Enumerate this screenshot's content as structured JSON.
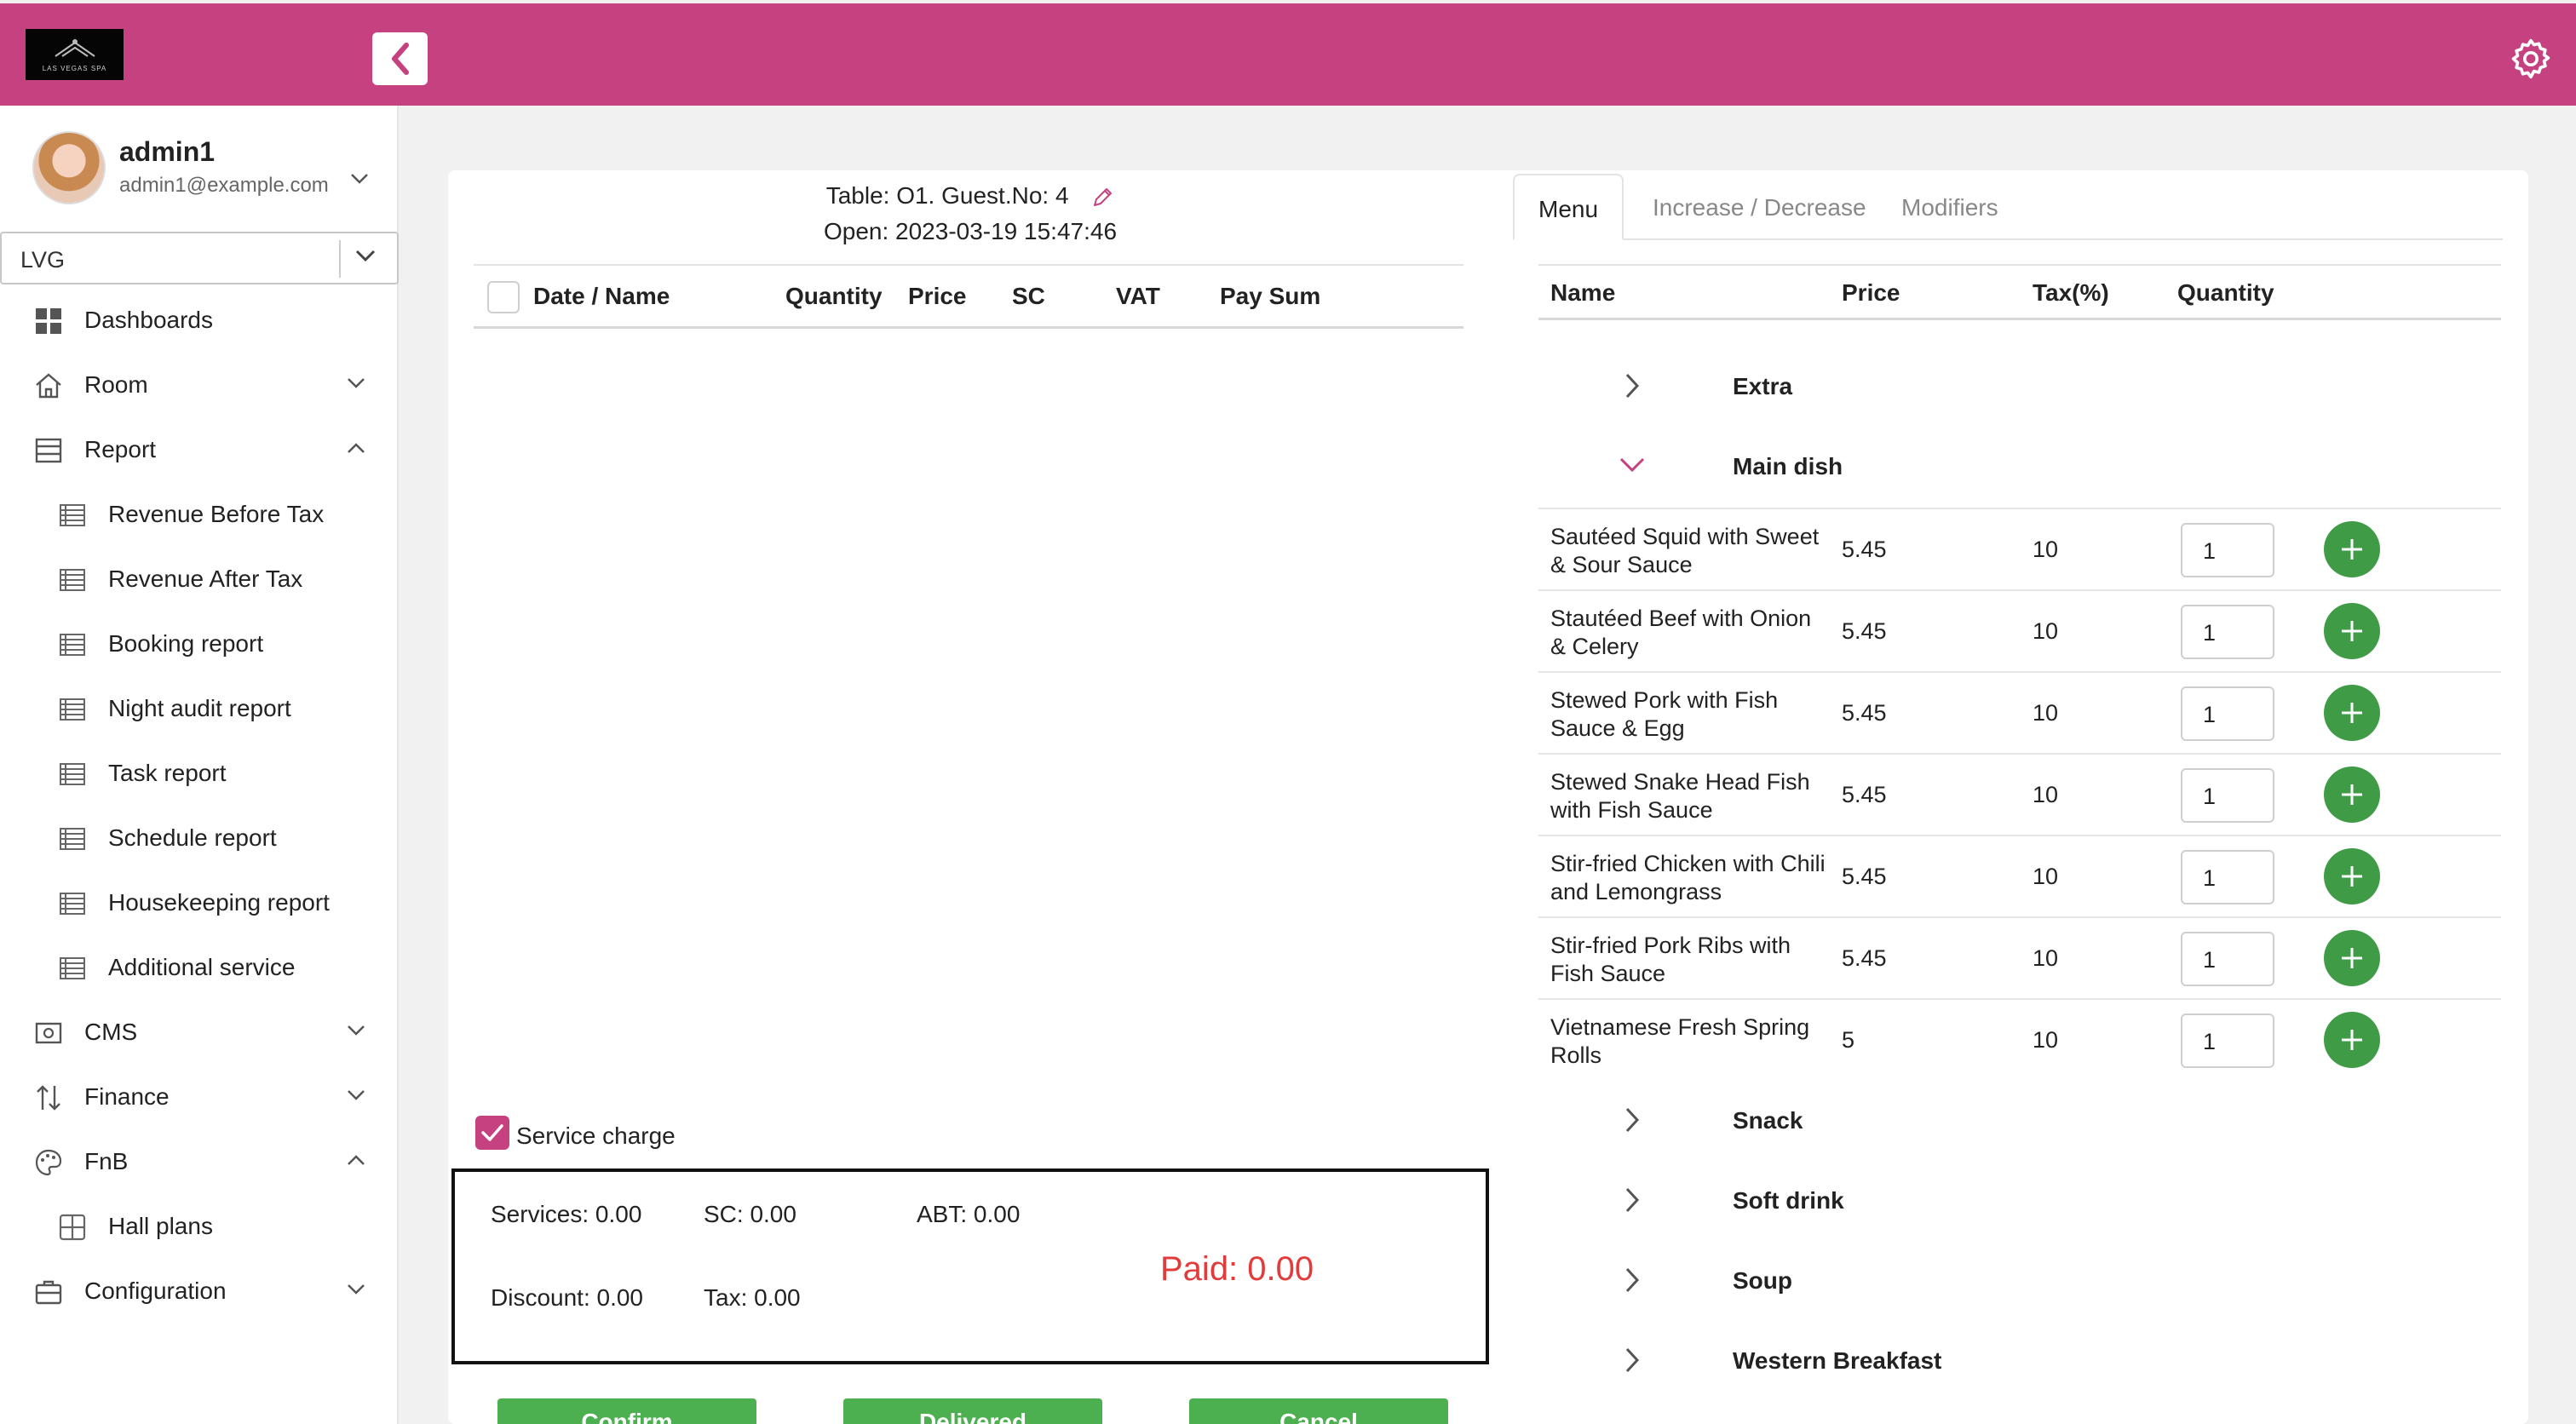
{
  "colors": {
    "brand": "#c6417f",
    "success": "#4caf50",
    "danger": "#e33b3b"
  },
  "logo": {
    "text": "LAS VEGAS SPA"
  },
  "user": {
    "name": "admin1",
    "email": "admin1@example.com"
  },
  "hotel_select": {
    "value": "LVG"
  },
  "nav": {
    "dashboards": "Dashboards",
    "room": "Room",
    "report": "Report",
    "report_items": [
      "Revenue Before Tax",
      "Revenue After Tax",
      "Booking report",
      "Night audit report",
      "Task report",
      "Schedule report",
      "Housekeeping report",
      "Additional service"
    ],
    "cms": "CMS",
    "finance": "Finance",
    "fnb": "FnB",
    "fnb_items": [
      "Hall plans"
    ],
    "configuration": "Configuration"
  },
  "order": {
    "table_line": "Table: O1. Guest.No: 4",
    "open_line": "Open: 2023-03-19 15:47:46",
    "columns": [
      "Date / Name",
      "Quantity",
      "Price",
      "SC",
      "VAT",
      "Pay Sum"
    ],
    "service_charge_label": "Service charge",
    "summary": {
      "services": "Services: 0.00",
      "sc": "SC: 0.00",
      "abt": "ABT: 0.00",
      "discount": "Discount: 0.00",
      "tax": "Tax: 0.00",
      "paid": "Paid: 0.00"
    },
    "buttons": {
      "confirm": "Confirm",
      "delivered": "Delivered",
      "cancel": "Cancel"
    }
  },
  "menu": {
    "tabs": [
      "Menu",
      "Increase / Decrease",
      "Modifiers"
    ],
    "columns": [
      "Name",
      "Price",
      "Tax(%)",
      "Quantity"
    ],
    "groups_before": [
      "Extra"
    ],
    "expanded_group": "Main dish",
    "items": [
      {
        "name": "Sautéed Squid with Sweet & Sour Sauce",
        "price": "5.45",
        "tax": "10",
        "qty": "1"
      },
      {
        "name": "Stautéed Beef with Onion & Celery",
        "price": "5.45",
        "tax": "10",
        "qty": "1"
      },
      {
        "name": "Stewed Pork with Fish Sauce & Egg",
        "price": "5.45",
        "tax": "10",
        "qty": "1"
      },
      {
        "name": "Stewed Snake Head Fish with Fish Sauce",
        "price": "5.45",
        "tax": "10",
        "qty": "1"
      },
      {
        "name": "Stir-fried Chicken with Chili and Lemongrass",
        "price": "5.45",
        "tax": "10",
        "qty": "1"
      },
      {
        "name": "Stir-fried Pork Ribs with Fish Sauce",
        "price": "5.45",
        "tax": "10",
        "qty": "1"
      },
      {
        "name": "Vietnamese Fresh Spring Rolls",
        "price": "5",
        "tax": "10",
        "qty": "1"
      }
    ],
    "groups_after": [
      "Snack",
      "Soft drink",
      "Soup",
      "Western Breakfast"
    ]
  }
}
